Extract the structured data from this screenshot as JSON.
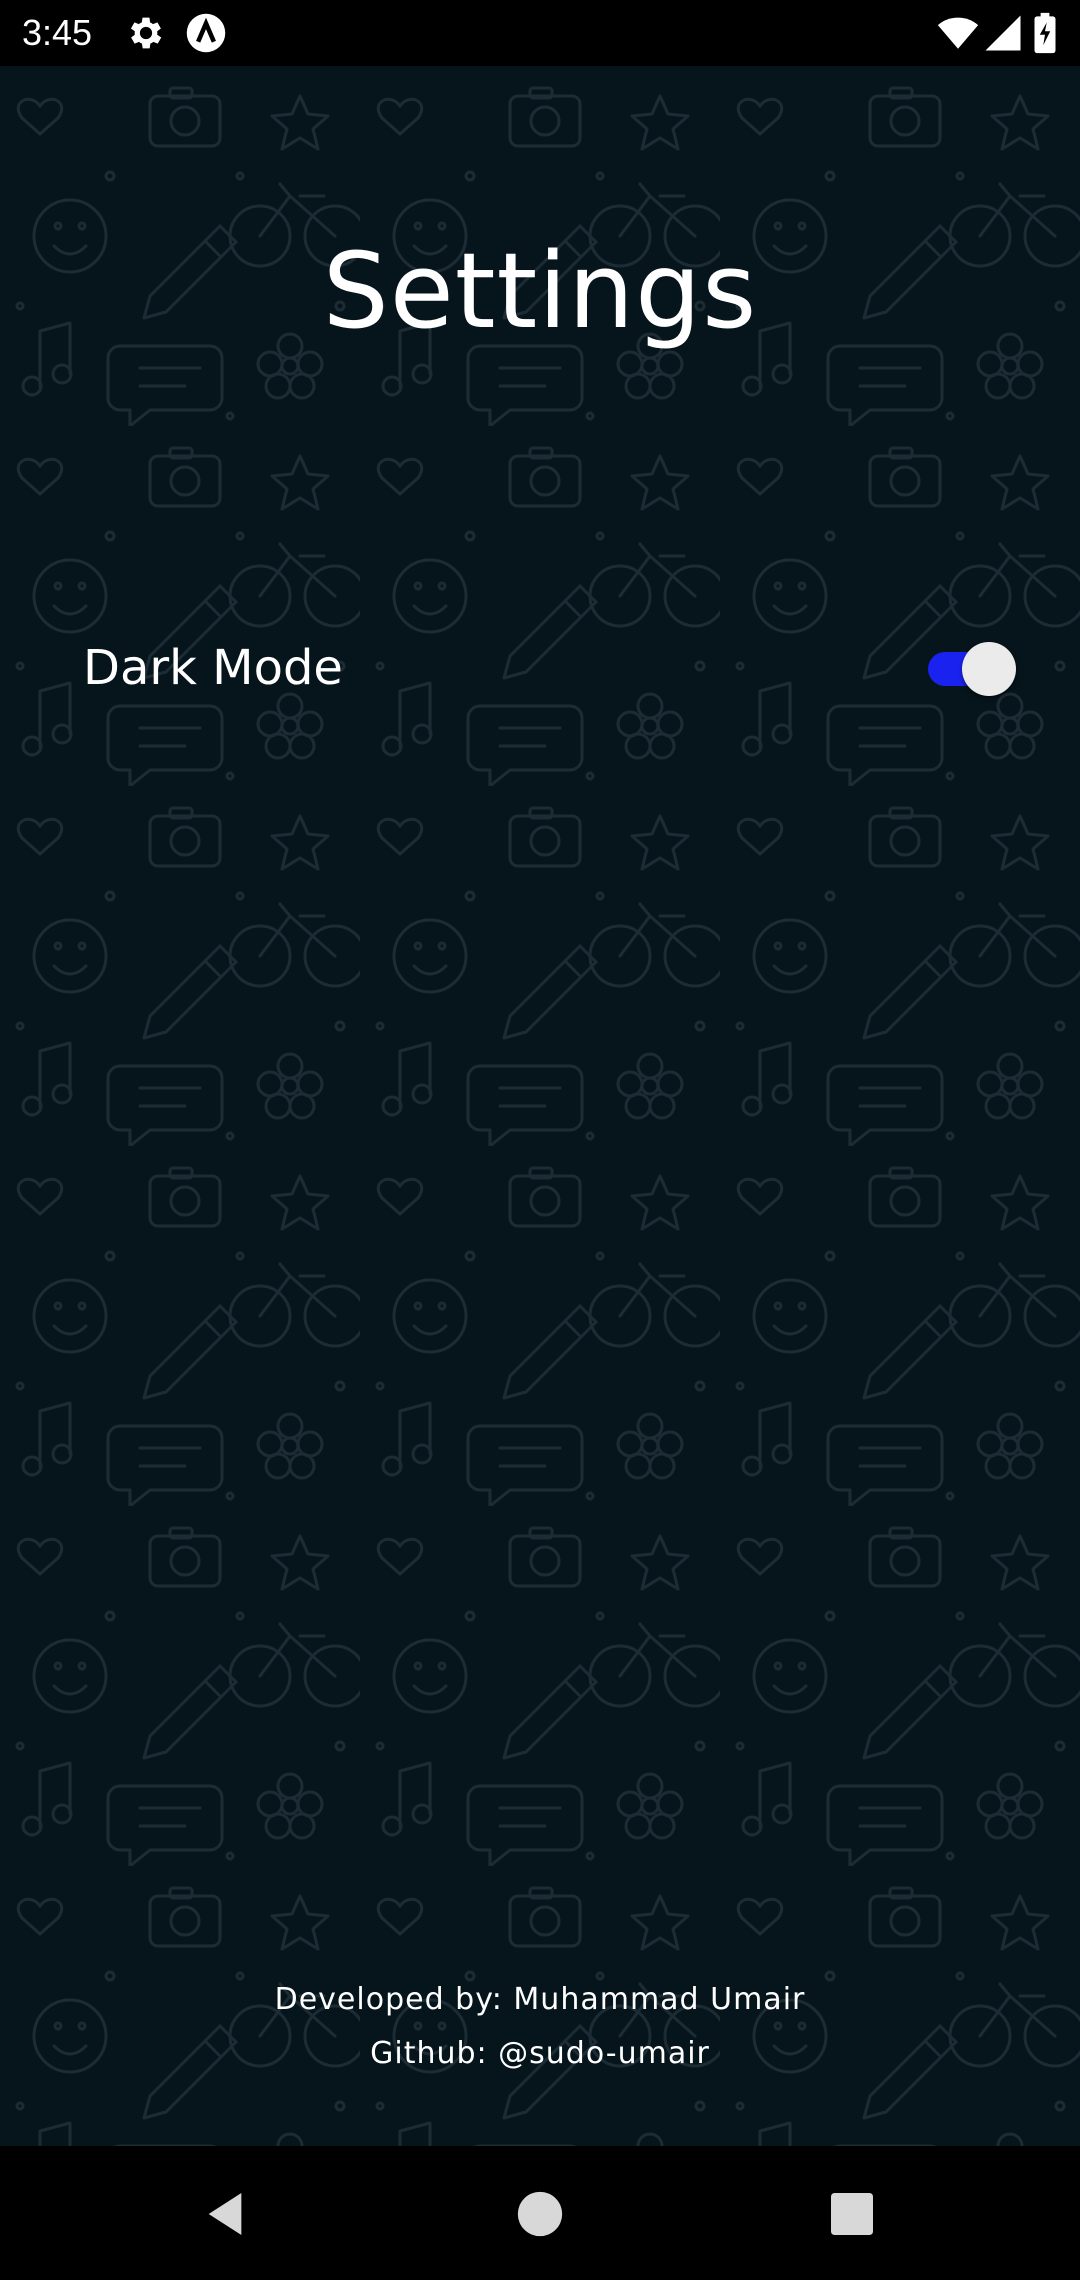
{
  "status_bar": {
    "time": "3:45",
    "left_icons": [
      "settings-gear-icon",
      "app-notification-icon"
    ],
    "right_icons": [
      "wifi-icon",
      "cellular-signal-icon",
      "battery-charging-icon"
    ]
  },
  "screen": {
    "title": "Settings",
    "background_color": "#06141c",
    "background_pattern": "doodle-pattern"
  },
  "settings": {
    "dark_mode": {
      "label": "Dark Mode",
      "enabled": true,
      "accent_color": "#1a22f0"
    }
  },
  "footer": {
    "developer": "Developed by: Muhammad Umair",
    "github": "Github: @sudo-umair"
  },
  "nav_bar": {
    "buttons": [
      "back-icon",
      "home-icon",
      "recents-icon"
    ]
  }
}
